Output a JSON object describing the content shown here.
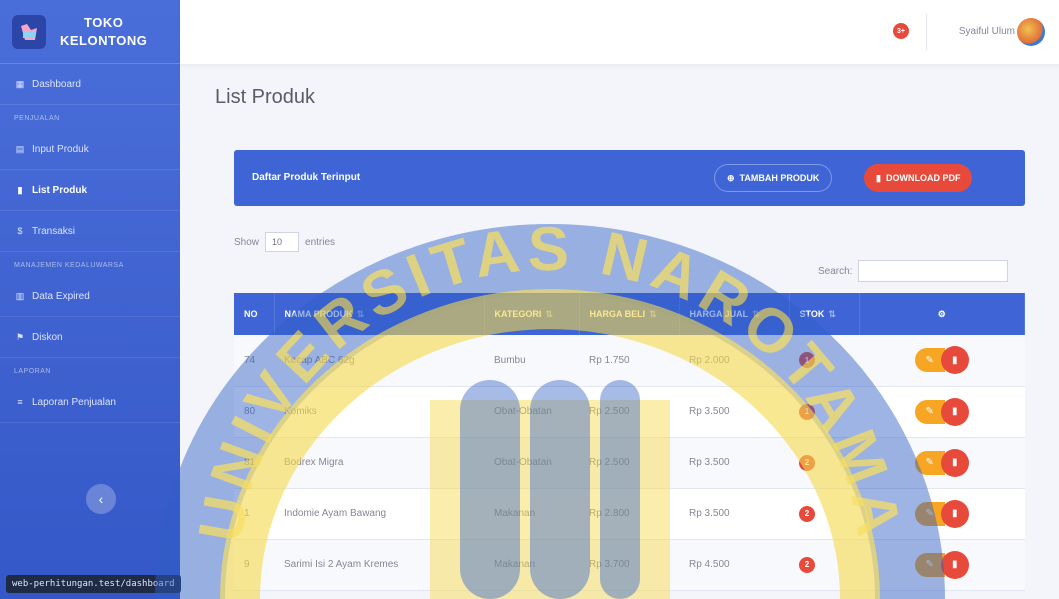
{
  "brand": {
    "line1": "TOKO",
    "line2": "KELONTONG"
  },
  "sidebar": {
    "items": [
      {
        "label": "Dashboard",
        "icon": "dashboard-icon"
      },
      {
        "heading": "PENJUALAN"
      },
      {
        "label": "Input Produk",
        "icon": "grid-icon"
      },
      {
        "label": "List Produk",
        "icon": "file-icon",
        "active": true
      },
      {
        "label": "Transaksi",
        "icon": "money-icon"
      },
      {
        "heading": "MANAJEMEN KEDALUWARSA"
      },
      {
        "label": "Data Expired",
        "icon": "table-icon"
      },
      {
        "label": "Diskon",
        "icon": "tag-icon"
      },
      {
        "heading": "LAPORAN"
      },
      {
        "label": "Laporan Penjualan",
        "icon": "chart-icon"
      }
    ]
  },
  "status_url": "web-perhitungan.test/dashboard",
  "topbar": {
    "notif_count": "3+",
    "username": "Syaiful Ulum"
  },
  "page_title": "List Produk",
  "card": {
    "title": "Daftar Produk Terinput",
    "add_label": "TAMBAH PRODUK",
    "pdf_label": "DOWNLOAD PDF"
  },
  "controls": {
    "show": "Show",
    "entries_value": "10",
    "entries": "entries",
    "search": "Search:"
  },
  "table": {
    "headers": [
      "NO",
      "NAMA PRODUK",
      "KATEGORI",
      "HARGA BELI",
      "HARGA JUAL",
      "STOK",
      ""
    ],
    "rows": [
      {
        "no": "74",
        "nama": "Kecap ABC 62g",
        "kategori": "Bumbu",
        "beli": "Rp 1.750",
        "jual": "Rp 2.000",
        "stok": "1"
      },
      {
        "no": "80",
        "nama": "Komiks",
        "kategori": "Obat-Obatan",
        "beli": "Rp 2.500",
        "jual": "Rp 3.500",
        "stok": "1"
      },
      {
        "no": "81",
        "nama": "Bodrex Migra",
        "kategori": "Obat-Obatan",
        "beli": "Rp 2.500",
        "jual": "Rp 3.500",
        "stok": "2"
      },
      {
        "no": "1",
        "nama": "Indomie Ayam Bawang",
        "kategori": "Makanan",
        "beli": "Rp 2.800",
        "jual": "Rp 3.500",
        "stok": "2"
      },
      {
        "no": "9",
        "nama": "Sarimi Isi 2 Ayam Kremes",
        "kategori": "Makanan",
        "beli": "Rp 3.700",
        "jual": "Rp 4.500",
        "stok": "2"
      }
    ]
  },
  "watermark": {
    "text": "UNIVERSITAS NAROTAMA"
  },
  "colors": {
    "primary": "#3e64d6",
    "danger": "#e74a3b",
    "warning": "#f6a623",
    "watermark_yellow": "#f5d84a",
    "watermark_blue": "#2f5fc4"
  }
}
